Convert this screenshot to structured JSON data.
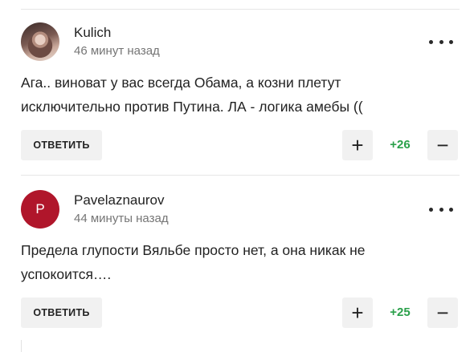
{
  "comments": [
    {
      "author": "Kulich",
      "timestamp": "46 минут назад",
      "avatar_type": "photo",
      "avatar_letter": "",
      "text": "Ага.. виноват у вас всегда Обама, а козни плетут исключительно против Путина. ЛА - логика амебы ((",
      "reply_label": "ОТВЕТИТЬ",
      "plus_label": "+",
      "score": "+26",
      "minus_label": "−"
    },
    {
      "author": "Pavelaznaurov",
      "timestamp": "44 минуты назад",
      "avatar_type": "letter",
      "avatar_letter": "P",
      "avatar_color": "#b0162b",
      "text": "Предела глупости Вяльбе просто нет, а она никак не успокоится….",
      "reply_label": "ОТВЕТИТЬ",
      "plus_label": "+",
      "score": "+25",
      "minus_label": "−"
    }
  ],
  "colors": {
    "score_positive": "#2aa04a",
    "button_bg": "#f1f1f1",
    "timestamp": "#757575"
  },
  "icons": {
    "more": "more-dots-icon",
    "plus": "plus-icon",
    "minus": "minus-icon"
  }
}
